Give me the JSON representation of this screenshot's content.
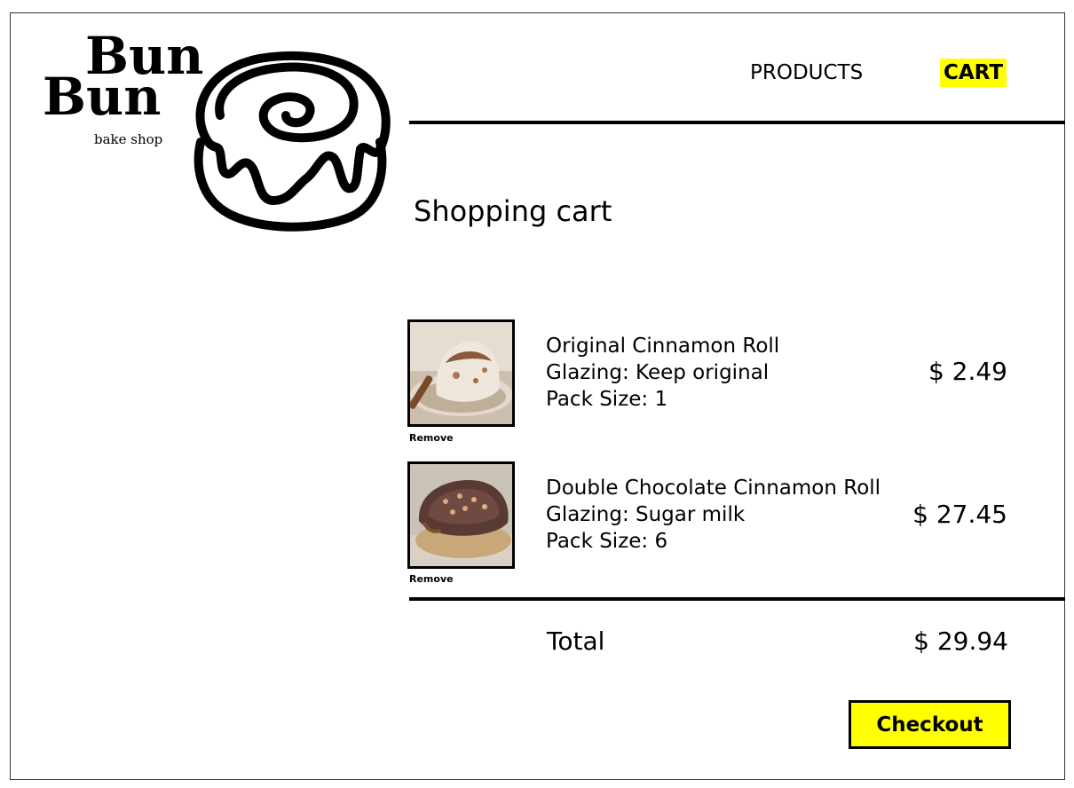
{
  "brand": {
    "line1": "Bun",
    "line2": "Bun",
    "tagline": "bake shop",
    "icon": "cinnamon-roll-icon"
  },
  "nav": {
    "products_label": "PRODUCTS",
    "cart_label": "CART",
    "active": "CART",
    "highlight_color": "#ffff00"
  },
  "page": {
    "title": "Shopping cart"
  },
  "cart": {
    "items": [
      {
        "name": "Original Cinnamon Roll",
        "glazing": "Glazing: Keep original",
        "pack_size": "Pack Size: 1",
        "price": "$ 2.49",
        "remove_label": "Remove",
        "image": "original-cinnamon-roll-photo"
      },
      {
        "name": "Double Chocolate Cinnamon Roll",
        "glazing": "Glazing: Sugar milk",
        "pack_size": "Pack Size: 6",
        "price": "$ 27.45",
        "remove_label": "Remove",
        "image": "double-chocolate-cinnamon-roll-photo"
      }
    ],
    "total_label": "Total",
    "total_value": "$ 29.94",
    "checkout_label": "Checkout"
  }
}
